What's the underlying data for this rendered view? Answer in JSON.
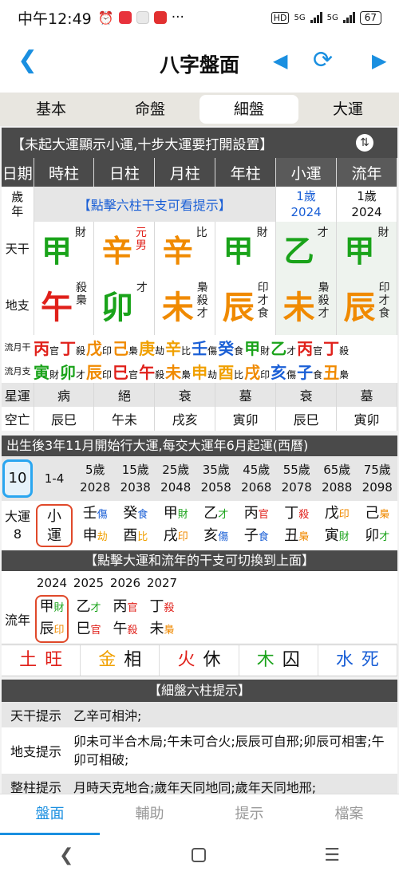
{
  "status": {
    "time": "中午12:49",
    "bat": "67",
    "hd": "HD",
    "net1": "5G",
    "net2": "5G"
  },
  "title": "八字盤面",
  "tabs": [
    "基本",
    "命盤",
    "細盤",
    "大運"
  ],
  "notice": "【未起大運顯示小運,十步大運要打開設置】",
  "cols": [
    "日期",
    "時柱",
    "日柱",
    "月柱",
    "年柱",
    "小運",
    "流年"
  ],
  "age_label": "歲\n年",
  "tip_click": "【點擊六柱干支可看提示】",
  "xiaoyun_age": "1歲",
  "xiaoyun_year": "2024",
  "liunian_age": "1歲",
  "liunian_year": "2024",
  "tiangan_label": "天干",
  "dizhi_label": "地支",
  "tiangan": [
    {
      "c": "甲",
      "color": "#1aa31a",
      "s": "財"
    },
    {
      "c": "辛",
      "color": "#f08a00",
      "s": "元\n男",
      "scolor": "#e0201a"
    },
    {
      "c": "辛",
      "color": "#f08a00",
      "s": "比"
    },
    {
      "c": "甲",
      "color": "#1aa31a",
      "s": "財"
    },
    {
      "c": "乙",
      "color": "#1aa31a",
      "s": "才"
    },
    {
      "c": "甲",
      "color": "#1aa31a",
      "s": "財"
    }
  ],
  "dizhi": [
    {
      "c": "午",
      "color": "#e0201a",
      "s": "殺\n梟"
    },
    {
      "c": "卯",
      "color": "#1aa31a",
      "s": "才"
    },
    {
      "c": "未",
      "color": "#f08a00",
      "s": "梟\n殺\n才"
    },
    {
      "c": "辰",
      "color": "#f08a00",
      "s": "印\n才\n食"
    },
    {
      "c": "未",
      "color": "#f08a00",
      "s": "梟\n殺\n才"
    },
    {
      "c": "辰",
      "color": "#f08a00",
      "s": "印\n才\n食"
    }
  ],
  "liuyue_gan_label": "流月干",
  "liuyue_zhi_label": "流月支",
  "liuyue_gan": [
    [
      "丙",
      "官",
      "#e0201a"
    ],
    [
      "丁",
      "殺",
      "#e0201a"
    ],
    [
      "戊",
      "印",
      "#f08a00"
    ],
    [
      "己",
      "梟",
      "#f08a00"
    ],
    [
      "庚",
      "劫",
      "#f0a000"
    ],
    [
      "辛",
      "比",
      "#f0a000"
    ],
    [
      "壬",
      "傷",
      "#1a5fd6"
    ],
    [
      "癸",
      "食",
      "#1a5fd6"
    ],
    [
      "甲",
      "財",
      "#1aa31a"
    ],
    [
      "乙",
      "才",
      "#1aa31a"
    ],
    [
      "丙",
      "官",
      "#e0201a"
    ],
    [
      "丁",
      "殺",
      "#e0201a"
    ]
  ],
  "liuyue_zhi": [
    [
      "寅",
      "財",
      "#1aa31a"
    ],
    [
      "卯",
      "才",
      "#1aa31a"
    ],
    [
      "辰",
      "印",
      "#f08a00"
    ],
    [
      "巳",
      "官",
      "#e0201a"
    ],
    [
      "午",
      "殺",
      "#e0201a"
    ],
    [
      "未",
      "梟",
      "#f08a00"
    ],
    [
      "申",
      "劫",
      "#f0a000"
    ],
    [
      "酉",
      "比",
      "#f0a000"
    ],
    [
      "戌",
      "印",
      "#f08a00"
    ],
    [
      "亥",
      "傷",
      "#1a5fd6"
    ],
    [
      "子",
      "食",
      "#1a5fd6"
    ],
    [
      "丑",
      "梟",
      "#f08a00"
    ]
  ],
  "xingyun_label": "星運",
  "xingyun": [
    "病",
    "絕",
    "衰",
    "墓",
    "衰",
    "墓"
  ],
  "kongwang_label": "空亡",
  "kongwang": [
    "辰巳",
    "午未",
    "戌亥",
    "寅卯",
    "辰巳",
    "寅卯"
  ],
  "dayun_notice": "出生後3年11月開始行大運,每交大運年6月起運(西曆)",
  "dayun_count": "10",
  "dayun_first": "1-4",
  "dayun_ages": [
    "5歲",
    "15歲",
    "25歲",
    "35歲",
    "45歲",
    "55歲",
    "65歲",
    "75歲"
  ],
  "dayun_years": [
    "2028",
    "2038",
    "2048",
    "2058",
    "2068",
    "2078",
    "2088",
    "2098"
  ],
  "dayun_label": "大運",
  "dayun_num": "8",
  "xiaoyun_label": "小\n運",
  "dayun_gz": [
    [
      "壬",
      "傷",
      "#1a5fd6",
      "申",
      "劫",
      "#f0a000"
    ],
    [
      "癸",
      "食",
      "#1a5fd6",
      "酉",
      "比",
      "#f0a000"
    ],
    [
      "甲",
      "財",
      "#1aa31a",
      "戌",
      "印",
      "#f08a00"
    ],
    [
      "乙",
      "才",
      "#1aa31a",
      "亥",
      "傷",
      "#1a5fd6"
    ],
    [
      "丙",
      "官",
      "#e0201a",
      "子",
      "食",
      "#1a5fd6"
    ],
    [
      "丁",
      "殺",
      "#e0201a",
      "丑",
      "梟",
      "#f08a00"
    ],
    [
      "戊",
      "印",
      "#f08a00",
      "寅",
      "財",
      "#1aa31a"
    ],
    [
      "己",
      "梟",
      "#f08a00",
      "卯",
      "才",
      "#1aa31a"
    ]
  ],
  "dayun_tip": "【點擊大運和流年的干支可切換到上面】",
  "liunian_label": "流年",
  "liunian_years": [
    "2024",
    "2025",
    "2026",
    "2027"
  ],
  "liunian_gz": [
    [
      "甲",
      "財",
      "#1aa31a",
      "辰",
      "印",
      "#f08a00"
    ],
    [
      "乙",
      "才",
      "#1aa31a",
      "巳",
      "官",
      "#e0201a"
    ],
    [
      "丙",
      "官",
      "#e0201a",
      "午",
      "殺",
      "#e0201a"
    ],
    [
      "丁",
      "殺",
      "#e0201a",
      "未",
      "梟",
      "#f08a00"
    ]
  ],
  "wuxing": [
    [
      "土",
      "旺",
      "#e0201a"
    ],
    [
      "金",
      "相",
      "#f0a000"
    ],
    [
      "火",
      "休",
      "#e0201a"
    ],
    [
      "木",
      "囚",
      "#1aa31a"
    ],
    [
      "水",
      "死",
      "#1a5fd6"
    ]
  ],
  "tips_title": "【細盤六柱提示】",
  "tips": [
    {
      "label": "天干提示",
      "text": "乙辛可相沖;"
    },
    {
      "label": "地支提示",
      "text": "卯未可半合木局;午未可合火;辰辰可自邢;卯辰可相害;午卯可相破;"
    },
    {
      "label": "整柱提示",
      "text": "月時天克地合;歲年天同地同;歲年天同地邢;"
    }
  ],
  "bottomnav": [
    "盤面",
    "輔助",
    "提示",
    "檔案"
  ]
}
